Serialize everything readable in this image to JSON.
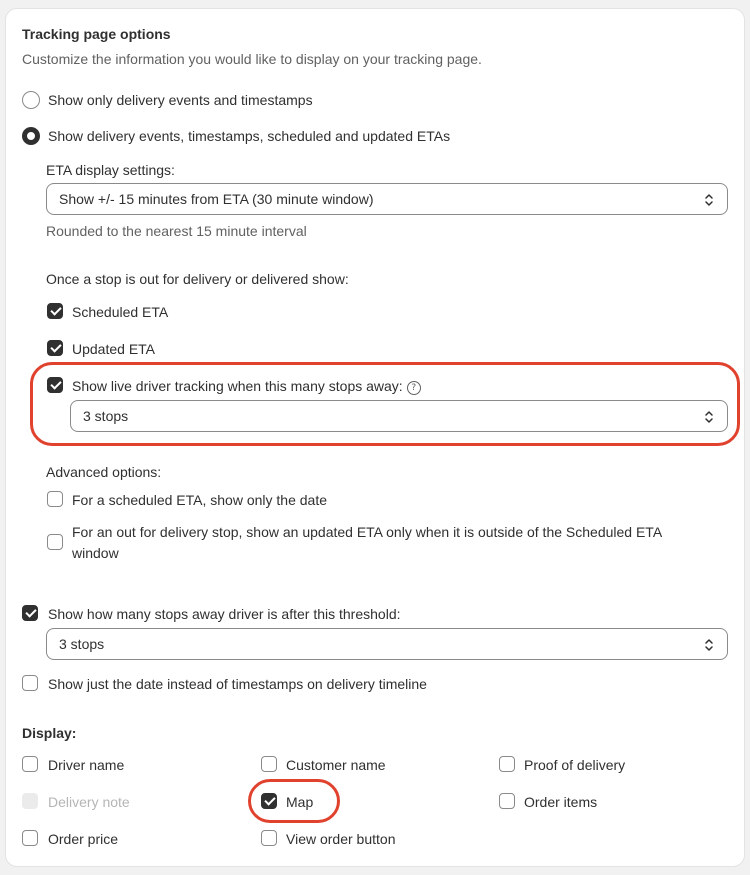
{
  "header": {
    "title": "Tracking page options",
    "subtitle": "Customize the information you would like to display on your tracking page."
  },
  "event_options": [
    {
      "label": "Show only delivery events and timestamps",
      "selected": false
    },
    {
      "label": "Show delivery events, timestamps, scheduled and updated ETAs",
      "selected": true
    }
  ],
  "eta_display": {
    "label": "ETA display settings:",
    "value": "Show +/- 15 minutes from ETA (30 minute window)",
    "help_text": "Rounded to the nearest 15 minute interval"
  },
  "out_for_delivery": {
    "heading": "Once a stop is out for delivery or delivered show:",
    "scheduled_eta": {
      "label": "Scheduled ETA",
      "checked": true
    },
    "updated_eta": {
      "label": "Updated ETA",
      "checked": true
    },
    "live_tracking": {
      "label": "Show live driver tracking when this many stops away:",
      "checked": true,
      "select_value": "3 stops",
      "help_icon": "?"
    }
  },
  "advanced": {
    "heading": "Advanced options:",
    "date_only": {
      "label": "For a scheduled ETA, show only the date",
      "checked": false
    },
    "updated_outside_line1": "For an out for delivery stop, show an updated ETA only when it is outside of the Scheduled ETA",
    "updated_outside_line2": "window",
    "updated_outside_checked": false
  },
  "stops_away": {
    "label": "Show how many stops away driver is after this threshold:",
    "checked": true,
    "select_value": "3 stops"
  },
  "date_instead": {
    "label": "Show just the date instead of timestamps on delivery timeline",
    "checked": false
  },
  "display": {
    "heading": "Display:",
    "items": {
      "driver_name": {
        "label": "Driver name",
        "checked": false
      },
      "customer_name": {
        "label": "Customer name",
        "checked": false
      },
      "proof_of_delivery": {
        "label": "Proof of delivery",
        "checked": false
      },
      "delivery_note": {
        "label": "Delivery note",
        "checked": false,
        "disabled": true
      },
      "map": {
        "label": "Map",
        "checked": true
      },
      "order_items": {
        "label": "Order items",
        "checked": false
      },
      "order_price": {
        "label": "Order price",
        "checked": false
      },
      "view_order_button": {
        "label": "View order button",
        "checked": false
      }
    }
  },
  "colors": {
    "highlight": "#e0422e",
    "text": "#303030",
    "muted": "#616161",
    "checked": "#303030"
  }
}
